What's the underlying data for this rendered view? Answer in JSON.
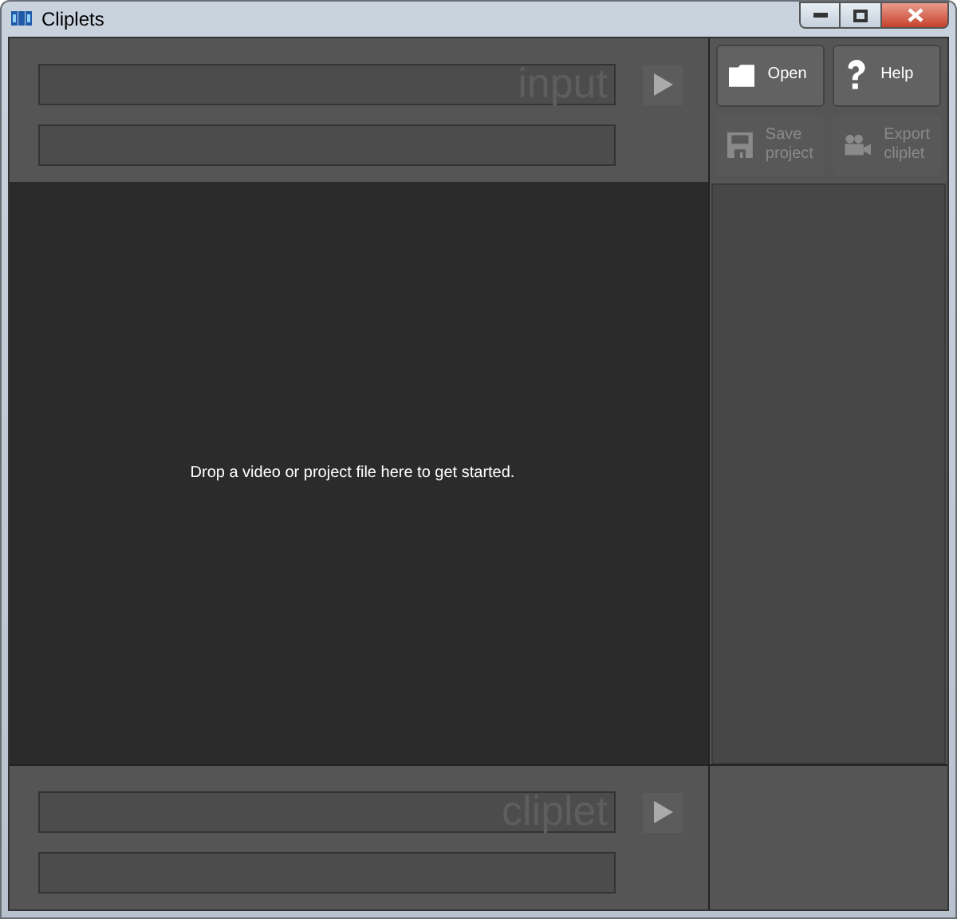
{
  "window": {
    "title": "Cliplets"
  },
  "input": {
    "label": "input"
  },
  "cliplet": {
    "label": "cliplet"
  },
  "buttons": [
    {
      "label": "Open",
      "kind": "folder",
      "disabled": false
    },
    {
      "label": "Help",
      "kind": "help",
      "disabled": false
    },
    {
      "label": "Save project",
      "kind": "save",
      "disabled": true
    },
    {
      "label": "Export cliplet",
      "kind": "camera",
      "disabled": true
    }
  ],
  "canvas": {
    "message": "Drop a video or project file here to get started."
  }
}
